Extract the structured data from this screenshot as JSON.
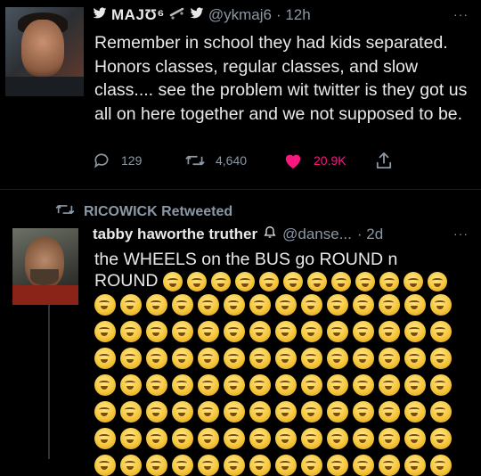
{
  "tweet1": {
    "display_name": "MAJƱ⁶",
    "handle": "@ykmaj6",
    "time": "· 12h",
    "menu": "···",
    "text": "Remember in school they had kids separated. Honors classes, regular classes, and slow class.... see the problem wit twitter is they got us all on here together and we not supposed to be.",
    "replies": "129",
    "retweets": "4,640",
    "likes": "20.9K",
    "icons": [
      "reply-icon",
      "retweet-icon",
      "heart-icon",
      "share-icon"
    ],
    "like_color": "#f91880"
  },
  "retweet_banner": {
    "label": "RICOWICK Retweeted"
  },
  "tweet2": {
    "display_name": "tabby haworthe truther",
    "handle": "@danse...",
    "time": "· 2d",
    "menu": "···",
    "text": "the WHEELS on the BUS go ROUND n ROUND",
    "emoji": "grimacing-face",
    "inline_emoji_count": 12,
    "grid_emoji_columns": 14,
    "grid_emoji_rows": 7
  }
}
